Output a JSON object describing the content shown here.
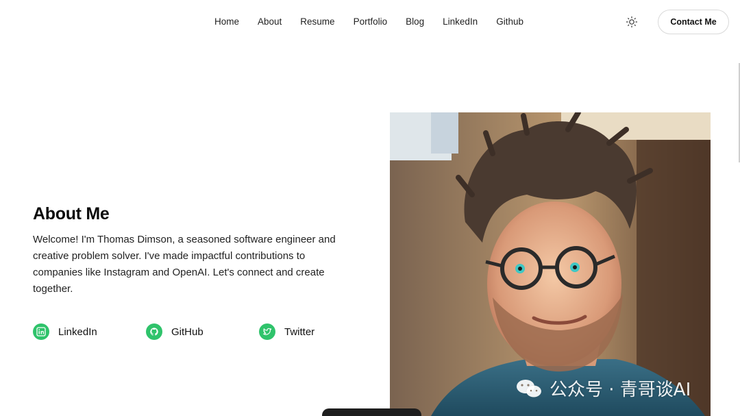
{
  "nav": {
    "links": [
      "Home",
      "About",
      "Resume",
      "Portfolio",
      "Blog",
      "LinkedIn",
      "Github"
    ],
    "theme_icon": "sun-icon",
    "contact_label": "Contact Me"
  },
  "about": {
    "title": "About Me",
    "text": "Welcome! I'm Thomas Dimson, a seasoned software engineer and creative problem solver. I've made impactful contributions to companies like Instagram and OpenAI. Let's connect and create together."
  },
  "social": [
    {
      "label": "LinkedIn",
      "icon": "linkedin-icon"
    },
    {
      "label": "GitHub",
      "icon": "github-icon"
    },
    {
      "label": "Twitter",
      "icon": "twitter-icon"
    }
  ],
  "photo": {
    "subject": "portrait-photo"
  },
  "watermark": {
    "text": "公众号 · 青哥谈AI"
  },
  "colors": {
    "accent": "#2fc36b",
    "text": "#111111",
    "background": "#ffffff"
  }
}
